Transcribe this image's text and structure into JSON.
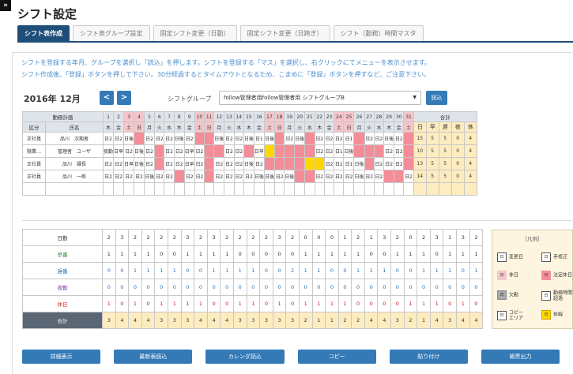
{
  "page": {
    "title": "シフト設定",
    "toggle": "»"
  },
  "tabs": [
    "シフト表作成",
    "シフト表グループ設定",
    "固定シフト変更（日勤）",
    "固定シフト変更（日跨ぎ）",
    "シフト（勤務）時間マスタ"
  ],
  "instructions": [
    "シフトを登録する年月、グループを選択し「読込」を押します。シフトを登録する「マス」を選択し、右クリックにてメニューを表示させます。",
    "シフト作成後、「登録」ボタンを押して下さい。30分経過するとタイムアウトとなるため、こまめに「登録」ボタンを押すなど、ご注意下さい。"
  ],
  "period": {
    "label": "2016年 12月",
    "prev": "<",
    "next": ">"
  },
  "shift_group": {
    "label": "シフトグループ",
    "value": "follow管理者用follow管理者用 シフトグループB",
    "load_label": "読込"
  },
  "grid": {
    "plan_label": "勤務計画",
    "category_label": "区分",
    "name_label": "氏名",
    "days": [
      "1",
      "2",
      "3",
      "4",
      "5",
      "6",
      "7",
      "8",
      "9",
      "10",
      "11",
      "12",
      "13",
      "14",
      "15",
      "16",
      "17",
      "18",
      "19",
      "20",
      "21",
      "22",
      "23",
      "24",
      "25",
      "26",
      "27",
      "28",
      "29",
      "30",
      "31"
    ],
    "weekdays": [
      "木",
      "金",
      "土",
      "日",
      "月",
      "火",
      "水",
      "木",
      "金",
      "土",
      "日",
      "月",
      "火",
      "水",
      "木",
      "金",
      "土",
      "日",
      "月",
      "火",
      "水",
      "木",
      "金",
      "土",
      "日",
      "月",
      "火",
      "水",
      "木",
      "金",
      "土"
    ],
    "total_label": "合計",
    "total_cols": [
      "日",
      "早",
      "遅",
      "夜",
      "休"
    ],
    "rows": [
      {
        "cat": "正社員",
        "name": "品川　次期者",
        "cells": [
          "日2",
          "日2",
          "日後",
          "",
          "日2",
          "日2",
          "日2",
          "日後",
          "日2",
          "",
          "",
          "日後",
          "日2",
          "日2",
          "日後",
          "日1",
          "日後",
          "",
          "日2",
          "日後",
          "",
          "日2",
          "日2",
          "日2",
          "日1",
          "",
          "日2",
          "日2",
          "日後",
          "日2",
          ""
        ],
        "totals": [
          "15",
          "5",
          "5",
          "0",
          "4"
        ]
      },
      {
        "cat": "限業…",
        "name": "管理者　ユーザ",
        "cells": [
          "夜勤",
          "日早",
          "日2",
          "日後",
          "日2",
          "",
          "日2",
          "日2",
          "日早",
          "日2",
          "",
          "",
          "日2",
          "日2",
          "",
          "日早",
          "",
          "",
          "",
          "",
          "",
          "日2",
          "日2",
          "日1",
          "日後",
          "",
          "",
          "",
          "日2",
          "日2",
          ""
        ],
        "totals": [
          "10",
          "5",
          "5",
          "0",
          "4"
        ]
      },
      {
        "cat": "正社員",
        "name": "品川　課長",
        "cells": [
          "日2",
          "日2",
          "日早",
          "日後",
          "日2",
          "",
          "日2",
          "日2",
          "日早",
          "日2",
          "",
          "日2",
          "日2",
          "日2",
          "日後",
          "日2",
          "",
          "",
          "",
          "",
          "",
          "",
          "日2",
          "日2",
          "日1",
          "日後",
          "",
          "日2",
          "日2",
          "日2",
          ""
        ],
        "totals": [
          "13",
          "5",
          "5",
          "0",
          "4"
        ]
      },
      {
        "cat": "正社員",
        "name": "品川　一郎",
        "cells": [
          "日2",
          "日2",
          "日2",
          "日2",
          "日後",
          "日2",
          "日2",
          "",
          "日2",
          "日2",
          "",
          "日2",
          "日2",
          "日2",
          "日2",
          "日後",
          "日後",
          "日2",
          "日後",
          "",
          "",
          "日2",
          "日2",
          "日2",
          "日2",
          "日後",
          "日2",
          "日2",
          "",
          "",
          "日2"
        ],
        "totals": [
          "14",
          "5",
          "5",
          "0",
          "4"
        ]
      }
    ]
  },
  "summary": {
    "rows": [
      {
        "label": "日勤",
        "values": [
          "2",
          "3",
          "2",
          "2",
          "2",
          "2",
          "3",
          "2",
          "3",
          "2",
          "2",
          "2",
          "2",
          "3",
          "2",
          "0",
          "0",
          "0",
          "1",
          "2",
          "1",
          "3",
          "2",
          "0",
          "2",
          "3",
          "1",
          "3",
          "2"
        ]
      },
      {
        "label": "早番",
        "values": [
          "1",
          "1",
          "1",
          "1",
          "0",
          "0",
          "1",
          "1",
          "1",
          "1",
          "0",
          "0",
          "0",
          "0",
          "0",
          "1",
          "1",
          "1",
          "1",
          "1",
          "0",
          "0",
          "1",
          "1",
          "1",
          "0",
          "1",
          "1",
          "1"
        ]
      },
      {
        "label": "遅番",
        "values": [
          "0",
          "0",
          "1",
          "1",
          "1",
          "1",
          "0",
          "0",
          "1",
          "1",
          "1",
          "1",
          "0",
          "0",
          "2",
          "1",
          "1",
          "0",
          "0",
          "1",
          "1",
          "1",
          "0",
          "0",
          "1",
          "1",
          "1",
          "0",
          "1"
        ]
      },
      {
        "label": "夜勤",
        "values": [
          "0",
          "0",
          "0",
          "0",
          "0",
          "0",
          "0",
          "0",
          "0",
          "0",
          "0",
          "0",
          "0",
          "0",
          "0",
          "0",
          "0",
          "0",
          "0",
          "0",
          "0",
          "0",
          "0",
          "0",
          "0",
          "0",
          "0",
          "0",
          "0"
        ]
      },
      {
        "label": "休日",
        "values": [
          "1",
          "0",
          "1",
          "0",
          "1",
          "1",
          "1",
          "1",
          "0",
          "0",
          "1",
          "1",
          "0",
          "1",
          "0",
          "1",
          "1",
          "1",
          "1",
          "0",
          "0",
          "0",
          "0",
          "1",
          "1",
          "1",
          "0",
          "1",
          "0"
        ]
      },
      {
        "label": "合計",
        "values": [
          "3",
          "4",
          "4",
          "4",
          "3",
          "3",
          "3",
          "4",
          "4",
          "4",
          "3",
          "3",
          "3",
          "3",
          "3",
          "2",
          "1",
          "1",
          "2",
          "2",
          "4",
          "4",
          "3",
          "2",
          "1",
          "4",
          "3",
          "4",
          "4"
        ]
      }
    ]
  },
  "legend": {
    "title": "［凡例］",
    "items": [
      {
        "label": "変更日"
      },
      {
        "label": "手修正"
      },
      {
        "label": "休日"
      },
      {
        "label": "法定休日"
      },
      {
        "label": "欠勤"
      },
      {
        "label": "勤務時間超過"
      },
      {
        "label": "コピーエリア"
      },
      {
        "label": "休暇"
      }
    ]
  },
  "buttons": [
    "詳細表示",
    "最新表読込",
    "カレンダ読込",
    "コピー",
    "貼り付け",
    "帳票出力"
  ]
}
